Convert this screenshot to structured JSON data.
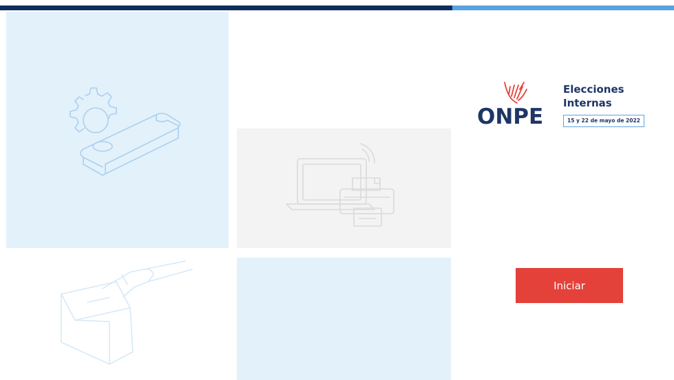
{
  "colors": {
    "bar_dark": "#0e2d5c",
    "bar_light": "#5aa2dd",
    "navy": "#1e3566",
    "accent_red": "#e3413a",
    "badge_text": "#1e3566",
    "tile_blue": "#e3f1fb",
    "tile_gray": "#f3f3f3",
    "line_blue": "#a9d0ef",
    "line_gray": "#dadada"
  },
  "tiles": {
    "usb_icon": "usb-key-gear-icon",
    "laptop_icon": "laptop-printer-icon",
    "ballot_icon": "ballot-box-icon"
  },
  "logo": {
    "brand": "ONPE",
    "hand_icon": "raised-hand-icon",
    "title_line1": "Elecciones",
    "title_line2": "Internas",
    "date": "15 y 22 de mayo de 2022"
  },
  "actions": {
    "start_label": "Iniciar"
  }
}
